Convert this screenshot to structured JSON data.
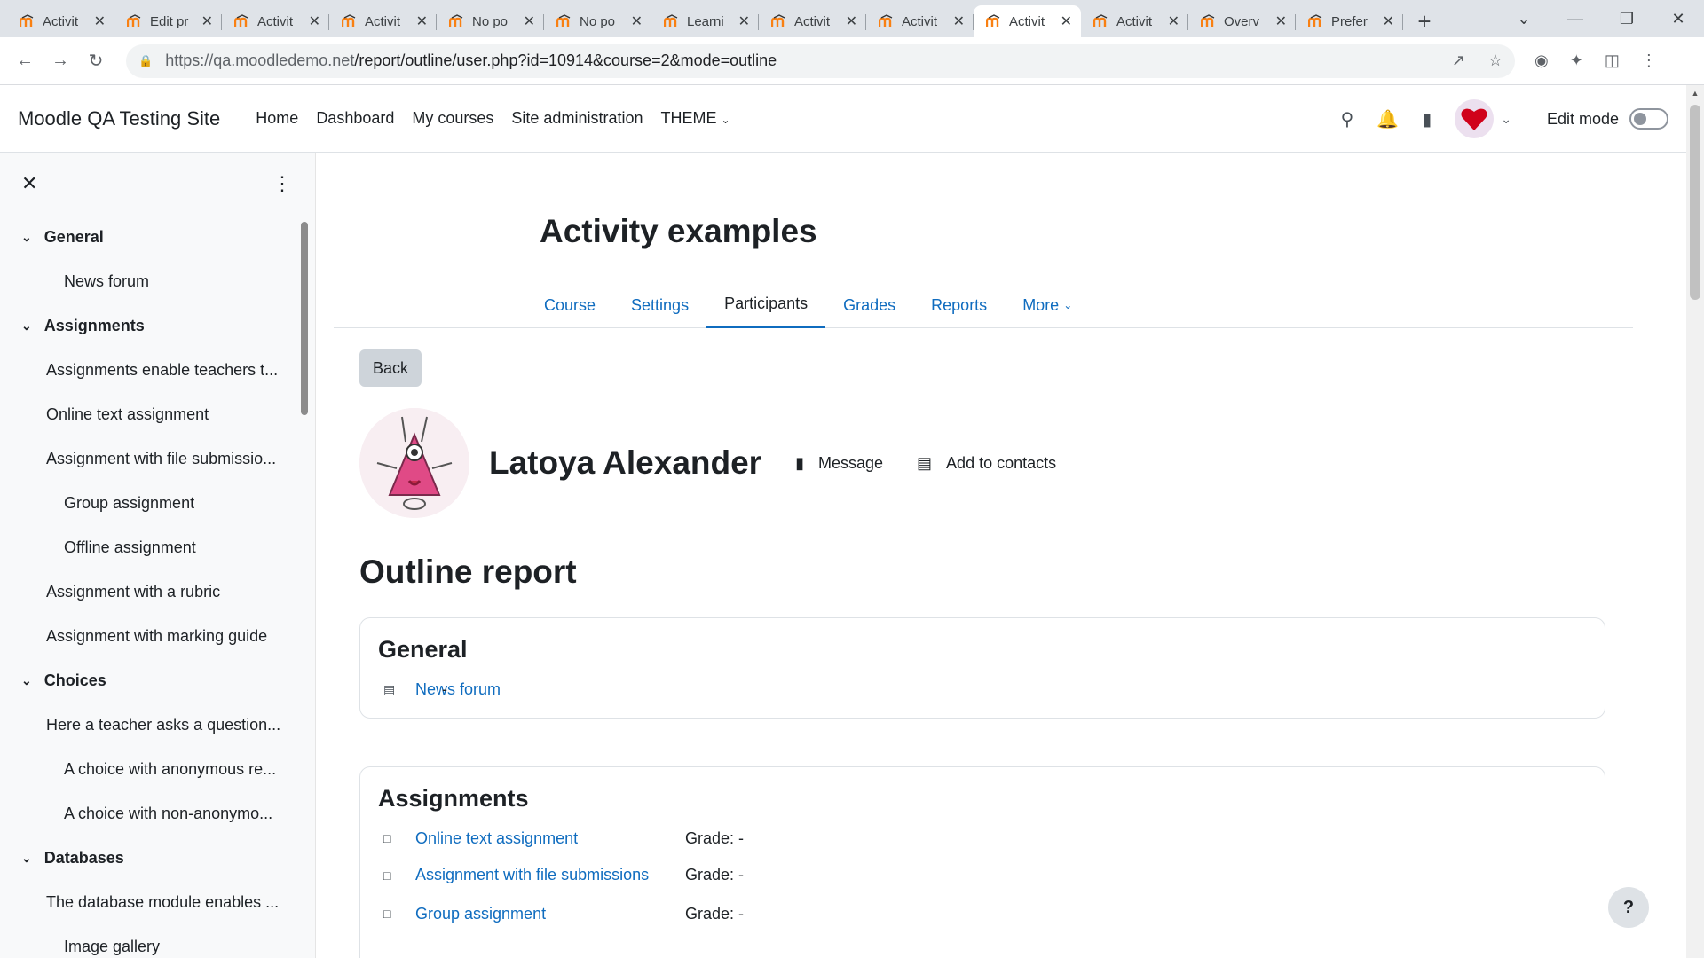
{
  "browser": {
    "tabs": [
      {
        "title": "Activit"
      },
      {
        "title": "Edit pr"
      },
      {
        "title": "Activit"
      },
      {
        "title": "Activit"
      },
      {
        "title": "No po"
      },
      {
        "title": "No po"
      },
      {
        "title": "Learni"
      },
      {
        "title": "Activit"
      },
      {
        "title": "Activit"
      },
      {
        "title": "Activit",
        "active": true
      },
      {
        "title": "Activit"
      },
      {
        "title": "Overv"
      },
      {
        "title": "Prefer"
      }
    ],
    "url_host": "https://qa.moodledemo.net",
    "url_path": "/report/outline/user.php?id=10914&course=2&mode=outline",
    "icons": [
      "back-icon",
      "forward-icon",
      "reload-icon",
      "lock-icon",
      "share-icon",
      "star-icon",
      "extension-icon",
      "puzzle-icon",
      "sidepanel-icon",
      "menu-icon"
    ]
  },
  "navbar": {
    "brand": "Moodle QA Testing Site",
    "links": [
      "Home",
      "Dashboard",
      "My courses",
      "Site administration",
      "THEME"
    ],
    "edit_mode": "Edit mode"
  },
  "course_index": {
    "sections": [
      {
        "title": "General",
        "items": [
          {
            "label": "News forum",
            "level": 2
          }
        ]
      },
      {
        "title": "Assignments",
        "items": [
          {
            "label": "Assignments enable teachers t...",
            "level": 1
          },
          {
            "label": "Online text assignment",
            "level": 1
          },
          {
            "label": "Assignment with file submissio...",
            "level": 1
          },
          {
            "label": "Group assignment",
            "level": 2
          },
          {
            "label": "Offline assignment",
            "level": 2
          },
          {
            "label": "Assignment with a rubric",
            "level": 1
          },
          {
            "label": "Assignment with marking guide",
            "level": 1
          }
        ]
      },
      {
        "title": "Choices",
        "items": [
          {
            "label": "Here a teacher asks a question...",
            "level": 1
          },
          {
            "label": "A choice with anonymous re...",
            "level": 2
          },
          {
            "label": "A choice with non-anonymo...",
            "level": 2
          }
        ]
      },
      {
        "title": "Databases",
        "items": [
          {
            "label": "The database module enables ...",
            "level": 1
          },
          {
            "label": "Image gallery",
            "level": 2
          }
        ]
      }
    ]
  },
  "course": {
    "title": "Activity examples",
    "tabs": [
      "Course",
      "Settings",
      "Participants",
      "Grades",
      "Reports",
      "More"
    ],
    "active_tab": "Participants"
  },
  "back_label": "Back",
  "user": {
    "name": "Latoya Alexander",
    "message": "Message",
    "add_contact": "Add to contacts"
  },
  "report": {
    "title": "Outline report",
    "sections": [
      {
        "title": "General",
        "rows": [
          {
            "name": "News forum",
            "info": "-",
            "icon": "forum-icon"
          }
        ]
      },
      {
        "title": "Assignments",
        "rows": [
          {
            "name": "Online text assignment",
            "info": "Grade: -",
            "icon": "assign-icon"
          },
          {
            "name": "Assignment with file submissions",
            "info": "Grade: -",
            "icon": "assign-icon"
          },
          {
            "name": "Group assignment",
            "info": "Grade: -",
            "icon": "assign-icon"
          }
        ]
      }
    ]
  },
  "help_label": "?"
}
